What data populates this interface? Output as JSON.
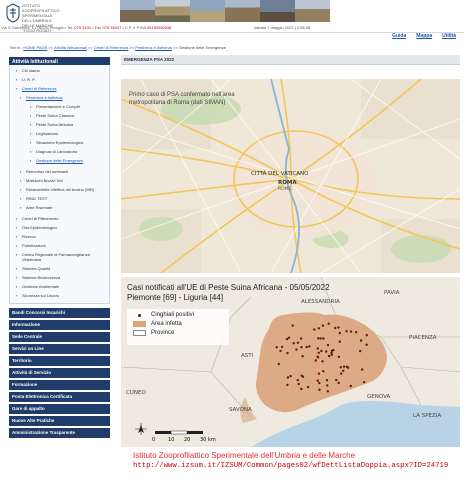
{
  "header": {
    "institute": [
      "ISTITUTO ZOOPROFILATTICO",
      "SPERIMENTALE",
      "DELL'UMBRIA E DELLE MARCHE",
      "\"TOGO ROSATI\""
    ],
    "address": "Via G.Salvemini, 1 • 06126 Perugia • Tel.",
    "tel": "075 3431",
    "fax_label": "• Fax",
    "fax": "075 35047",
    "cf_label": "• C.F. e P.IVA",
    "cf": "00150090546",
    "date": "sabato 7 maggio 2022 | 2:38:38"
  },
  "top_links": [
    "Guida",
    "Mappa",
    "Utilità"
  ],
  "breadcrumb": {
    "prefix": "Sei in :",
    "items": [
      "HOME PAGE",
      "Attività Istituzionali",
      "Centri di Referenza",
      "Pestivirus e Asfivirus"
    ],
    "current": "Gestione delle Emergenze",
    "separator": ">>"
  },
  "sidebar": {
    "heading": "Attività Istituzionali",
    "items": [
      {
        "label": "Chi siamo",
        "level": 1,
        "link": false
      },
      {
        "label": "U. R. P.",
        "level": 1,
        "link": false
      },
      {
        "label": "Centri di Referenza",
        "level": 1,
        "link": true
      },
      {
        "label": "Pestivirus e Asfivirus",
        "level": 2,
        "link": true
      },
      {
        "label": "Presentazione e Compiti",
        "level": 3,
        "link": false
      },
      {
        "label": "Peste Suina Classica",
        "level": 3,
        "link": false
      },
      {
        "label": "Peste Suina Africana",
        "level": 3,
        "link": false
      },
      {
        "label": "Legislazione",
        "level": 3,
        "link": false
      },
      {
        "label": "Situazione Epidemiologica",
        "level": 3,
        "link": false
      },
      {
        "label": "Diagnosi di Laboratorio",
        "level": 3,
        "link": false
      },
      {
        "label": "Gestione delle Emergenze",
        "level": 3,
        "link": true
      },
      {
        "label": "Retrovirus dei ruminanti",
        "level": 2,
        "link": false
      },
      {
        "label": "Mollucchi Bivalvi Vivi",
        "level": 2,
        "link": false
      },
      {
        "label": "Rinotracheite infettiva del bovino (IBR)",
        "level": 2,
        "link": false
      },
      {
        "label": "RING TEST",
        "level": 2,
        "link": false
      },
      {
        "label": "Aree Riservate",
        "level": 2,
        "link": false
      },
      {
        "label": "Centri di Riferimento",
        "level": 1,
        "link": false
      },
      {
        "label": "Oss.Epidemiologico",
        "level": 1,
        "link": false
      },
      {
        "label": "Ricerca",
        "level": 1,
        "link": false
      },
      {
        "label": "Pubblicazioni",
        "level": 1,
        "link": false
      },
      {
        "label": "Centro Regionale di Farmacovigilanza Veterinaria",
        "level": 1,
        "link": false
      },
      {
        "label": "Sistema Qualità",
        "level": 1,
        "link": false
      },
      {
        "label": "Sistema Biosicurezza",
        "level": 1,
        "link": false
      },
      {
        "label": "Gestione Ambientale",
        "level": 1,
        "link": false
      },
      {
        "label": "Sicurezza sul Lavoro",
        "level": 1,
        "link": false
      }
    ],
    "sections": [
      "Bandi Concorsi Incarichi",
      "Informazione",
      "Sede Centrale",
      "Servizi on Line",
      "Territorio",
      "Attività di Servizio",
      "Formazione",
      "Posta Elettronica Certificata",
      "Gare di appalto",
      "Nuove Alte Pratiche",
      "Amministrazione Trasparente"
    ]
  },
  "main": {
    "title": "EMERGENZA PSA 2022",
    "map1": {
      "annotation": "Primo caso di PSA confermato nell'area metropolitana di Roma (dati SIMAN)",
      "labels": [
        "CITTÀ DEL VATICANO",
        "ROMA",
        "ROME"
      ]
    },
    "map2": {
      "title": "Casi notificati all'UE di Peste Suina Africana - 05/05/2022",
      "subtitle": "Piemonte [69] - Liguria [44]",
      "legend": [
        "Cinghiali positivi",
        "Area infetta",
        "Province"
      ],
      "places": [
        "PAVIA",
        "ALESSANDRIA",
        "PIACENZA",
        "ASTI",
        "GENOVA",
        "CUNEO",
        "SAVONA",
        "LA SPEZIA"
      ],
      "scale": [
        "0",
        "10",
        "20",
        "30 km"
      ]
    },
    "caption_name": "Istituto Zooprofilattico Sperimentale dell'Umbria e delle Marche",
    "caption_url": "http://www.izsum.it/IZSUM/Common/pages02/wfDettListaDoppia.aspx?ID=24719"
  }
}
